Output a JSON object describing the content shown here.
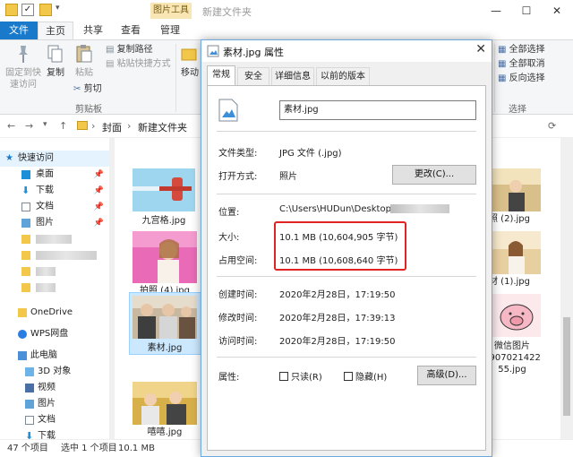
{
  "window": {
    "title": "新建文件夹",
    "context_tab": "图片工具"
  },
  "tabs": [
    "文件",
    "主页",
    "共享",
    "查看",
    "管理"
  ],
  "ribbon": {
    "pin_label": "固定到快\n速访问",
    "copy_label": "复制",
    "paste_label": "粘贴",
    "copy_path": "复制路径",
    "paste_shortcut": "粘贴快捷方式",
    "cut": "剪切",
    "clipboard_group": "剪贴板",
    "move_to_label": "移动",
    "select_all": "全部选择",
    "select_none": "全部取消",
    "invert_select": "反向选择",
    "select_group": "选择"
  },
  "address": {
    "crumbs": [
      "封面",
      "新建文件夹"
    ]
  },
  "nav": {
    "quick_access": "快速访问",
    "items": [
      "桌面",
      "下载",
      "文档",
      "图片"
    ],
    "onedrive": "OneDrive",
    "wps": "WPS网盘",
    "this_pc": "此电脑",
    "pc_items": [
      "3D 对象",
      "视频",
      "图片",
      "文档",
      "下载"
    ]
  },
  "files": {
    "left": [
      "九宫格.jpg",
      "拍照 (4).jpg",
      "素材.jpg",
      "嘻嘻.jpg"
    ],
    "right": [
      "拍照 (2).jpg",
      "素材 (1).jpg",
      "微信图片\n1907021422\n55.jpg"
    ]
  },
  "status": {
    "count": "47 个项目",
    "selected": "选中 1 个项目",
    "size": "10.1 MB"
  },
  "dialog": {
    "title": "素材.jpg 属性",
    "tabs": [
      "常规",
      "安全",
      "详细信息",
      "以前的版本"
    ],
    "filename": "素材.jpg",
    "type_label": "文件类型:",
    "type_value": "JPG 文件 (.jpg)",
    "open_label": "打开方式:",
    "open_value": "照片",
    "change_button": "更改(C)...",
    "location_label": "位置:",
    "location_value": "C:\\Users\\HUDun\\Desktop\\",
    "size_label": "大小:",
    "size_value": "10.1 MB (10,604,905 字节)",
    "disk_label": "占用空间:",
    "disk_value": "10.1 MB (10,608,640 字节)",
    "created_label": "创建时间:",
    "created_value": "2020年2月28日，17:19:50",
    "modified_label": "修改时间:",
    "modified_value": "2020年2月28日，17:39:13",
    "accessed_label": "访问时间:",
    "accessed_value": "2020年2月28日，17:19:50",
    "attr_label": "属性:",
    "readonly": "只读(R)",
    "hidden": "隐藏(H)",
    "advanced_button": "高级(D)..."
  },
  "colors": {
    "accent": "#1979ca",
    "highlight_box": "#e02424",
    "context_tab": "#f8e7b4"
  }
}
